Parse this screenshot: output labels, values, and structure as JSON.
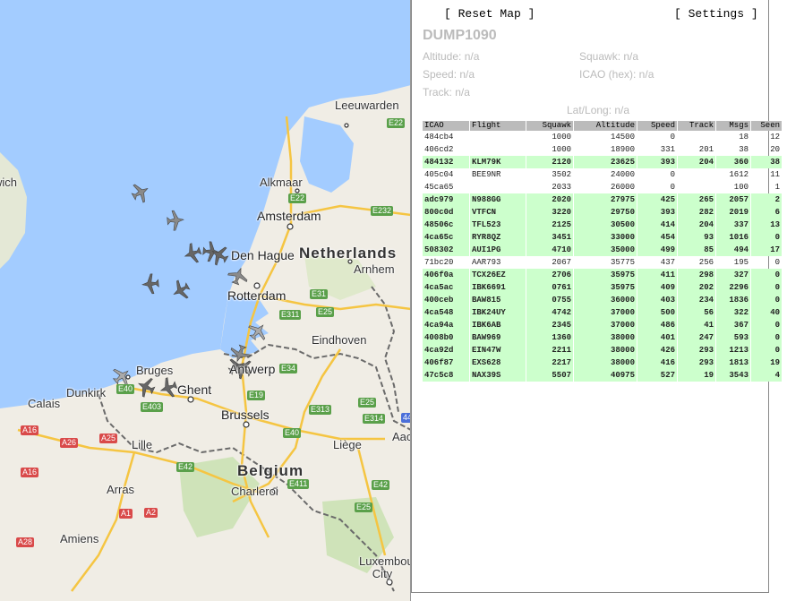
{
  "app": {
    "title": "DUMP1090"
  },
  "toolbar": {
    "reset_label": "[ Reset Map ]",
    "settings_label": "[ Settings ]"
  },
  "info": {
    "altitude": "Altitude: n/a",
    "squawk": "Squawk: n/a",
    "speed": "Speed: n/a",
    "icao": "ICAO (hex): n/a",
    "track": "Track: n/a",
    "latlong": "Lat/Long: n/a"
  },
  "map": {
    "cities": [
      "Leeuwarden",
      "Alkmaar",
      "Amsterdam",
      "Den Hague",
      "Rotterdam",
      "Arnhem",
      "Eindhoven",
      "Antwerp",
      "Bruges",
      "Ghent",
      "Brussels",
      "Liège",
      "Charleroi",
      "Lille",
      "Arras",
      "Amiens",
      "Calais",
      "Dunkirk",
      "Luxembourg City",
      "Aachen",
      "Norwich"
    ],
    "countries": [
      "Netherlands",
      "Belgium"
    ],
    "roads": [
      "E22",
      "E22",
      "E232",
      "E31",
      "E311",
      "E25",
      "E34",
      "E40",
      "E403",
      "E19",
      "E313",
      "E25",
      "E314",
      "E40",
      "E42",
      "E411",
      "E42",
      "E25",
      "A16",
      "A26",
      "A25",
      "A16",
      "A1",
      "A2",
      "A28",
      "44"
    ],
    "colors": {
      "water": "#a3ccff",
      "land": "#f0ede5",
      "motorway": "#f5c542",
      "border": "#6a6a6a",
      "road_shield": "#5aa04a"
    }
  },
  "table": {
    "headers": [
      "ICAO",
      "Flight",
      "Squawk",
      "Altitude",
      "Speed",
      "Track",
      "Msgs",
      "Seen"
    ],
    "rows": [
      {
        "icao": "484cb4",
        "flight": "",
        "squawk": "1000",
        "altitude": "14500",
        "speed": "0",
        "track": "",
        "msgs": "18",
        "seen": "12",
        "vis": false
      },
      {
        "icao": "406cd2",
        "flight": "",
        "squawk": "1000",
        "altitude": "18900",
        "speed": "331",
        "track": "201",
        "msgs": "38",
        "seen": "20",
        "vis": false
      },
      {
        "icao": "484132",
        "flight": "KLM79K",
        "squawk": "2120",
        "altitude": "23625",
        "speed": "393",
        "track": "204",
        "msgs": "360",
        "seen": "38",
        "vis": true
      },
      {
        "icao": "405c04",
        "flight": "BEE9NR",
        "squawk": "3502",
        "altitude": "24000",
        "speed": "0",
        "track": "",
        "msgs": "1612",
        "seen": "11",
        "vis": false
      },
      {
        "icao": "45ca65",
        "flight": "",
        "squawk": "2033",
        "altitude": "26000",
        "speed": "0",
        "track": "",
        "msgs": "100",
        "seen": "1",
        "vis": false
      },
      {
        "icao": "adc979",
        "flight": "N988GG",
        "squawk": "2020",
        "altitude": "27975",
        "speed": "425",
        "track": "265",
        "msgs": "2057",
        "seen": "2",
        "vis": true
      },
      {
        "icao": "800c0d",
        "flight": "VTFCN",
        "squawk": "3220",
        "altitude": "29750",
        "speed": "393",
        "track": "282",
        "msgs": "2019",
        "seen": "6",
        "vis": true
      },
      {
        "icao": "48506c",
        "flight": "TFL523",
        "squawk": "2125",
        "altitude": "30500",
        "speed": "414",
        "track": "204",
        "msgs": "337",
        "seen": "13",
        "vis": true
      },
      {
        "icao": "4ca65c",
        "flight": "RYR8QZ",
        "squawk": "3451",
        "altitude": "33000",
        "speed": "454",
        "track": "93",
        "msgs": "1016",
        "seen": "0",
        "vis": true
      },
      {
        "icao": "508302",
        "flight": "AUI1PG",
        "squawk": "4710",
        "altitude": "35000",
        "speed": "499",
        "track": "85",
        "msgs": "494",
        "seen": "17",
        "vis": true
      },
      {
        "icao": "71bc20",
        "flight": "AAR793",
        "squawk": "2067",
        "altitude": "35775",
        "speed": "437",
        "track": "256",
        "msgs": "195",
        "seen": "0",
        "vis": false
      },
      {
        "icao": "406f0a",
        "flight": "TCX26EZ",
        "squawk": "2706",
        "altitude": "35975",
        "speed": "411",
        "track": "298",
        "msgs": "327",
        "seen": "0",
        "vis": true
      },
      {
        "icao": "4ca5ac",
        "flight": "IBK6691",
        "squawk": "0761",
        "altitude": "35975",
        "speed": "409",
        "track": "202",
        "msgs": "2296",
        "seen": "0",
        "vis": true
      },
      {
        "icao": "400ceb",
        "flight": "BAW815",
        "squawk": "0755",
        "altitude": "36000",
        "speed": "403",
        "track": "234",
        "msgs": "1836",
        "seen": "0",
        "vis": true
      },
      {
        "icao": "4ca548",
        "flight": "IBK24UY",
        "squawk": "4742",
        "altitude": "37000",
        "speed": "500",
        "track": "56",
        "msgs": "322",
        "seen": "40",
        "vis": true
      },
      {
        "icao": "4ca94a",
        "flight": "IBK6AB",
        "squawk": "2345",
        "altitude": "37000",
        "speed": "486",
        "track": "41",
        "msgs": "367",
        "seen": "0",
        "vis": true
      },
      {
        "icao": "4008b0",
        "flight": "BAW969",
        "squawk": "1360",
        "altitude": "38000",
        "speed": "401",
        "track": "247",
        "msgs": "593",
        "seen": "0",
        "vis": true
      },
      {
        "icao": "4ca92d",
        "flight": "EIN47W",
        "squawk": "2211",
        "altitude": "38000",
        "speed": "426",
        "track": "293",
        "msgs": "1213",
        "seen": "0",
        "vis": true
      },
      {
        "icao": "406f87",
        "flight": "EXS628",
        "squawk": "2217",
        "altitude": "38000",
        "speed": "416",
        "track": "293",
        "msgs": "1813",
        "seen": "19",
        "vis": true
      },
      {
        "icao": "47c5c8",
        "flight": "NAX39S",
        "squawk": "5507",
        "altitude": "40975",
        "speed": "527",
        "track": "19",
        "msgs": "3543",
        "seen": "4",
        "vis": true
      }
    ]
  }
}
